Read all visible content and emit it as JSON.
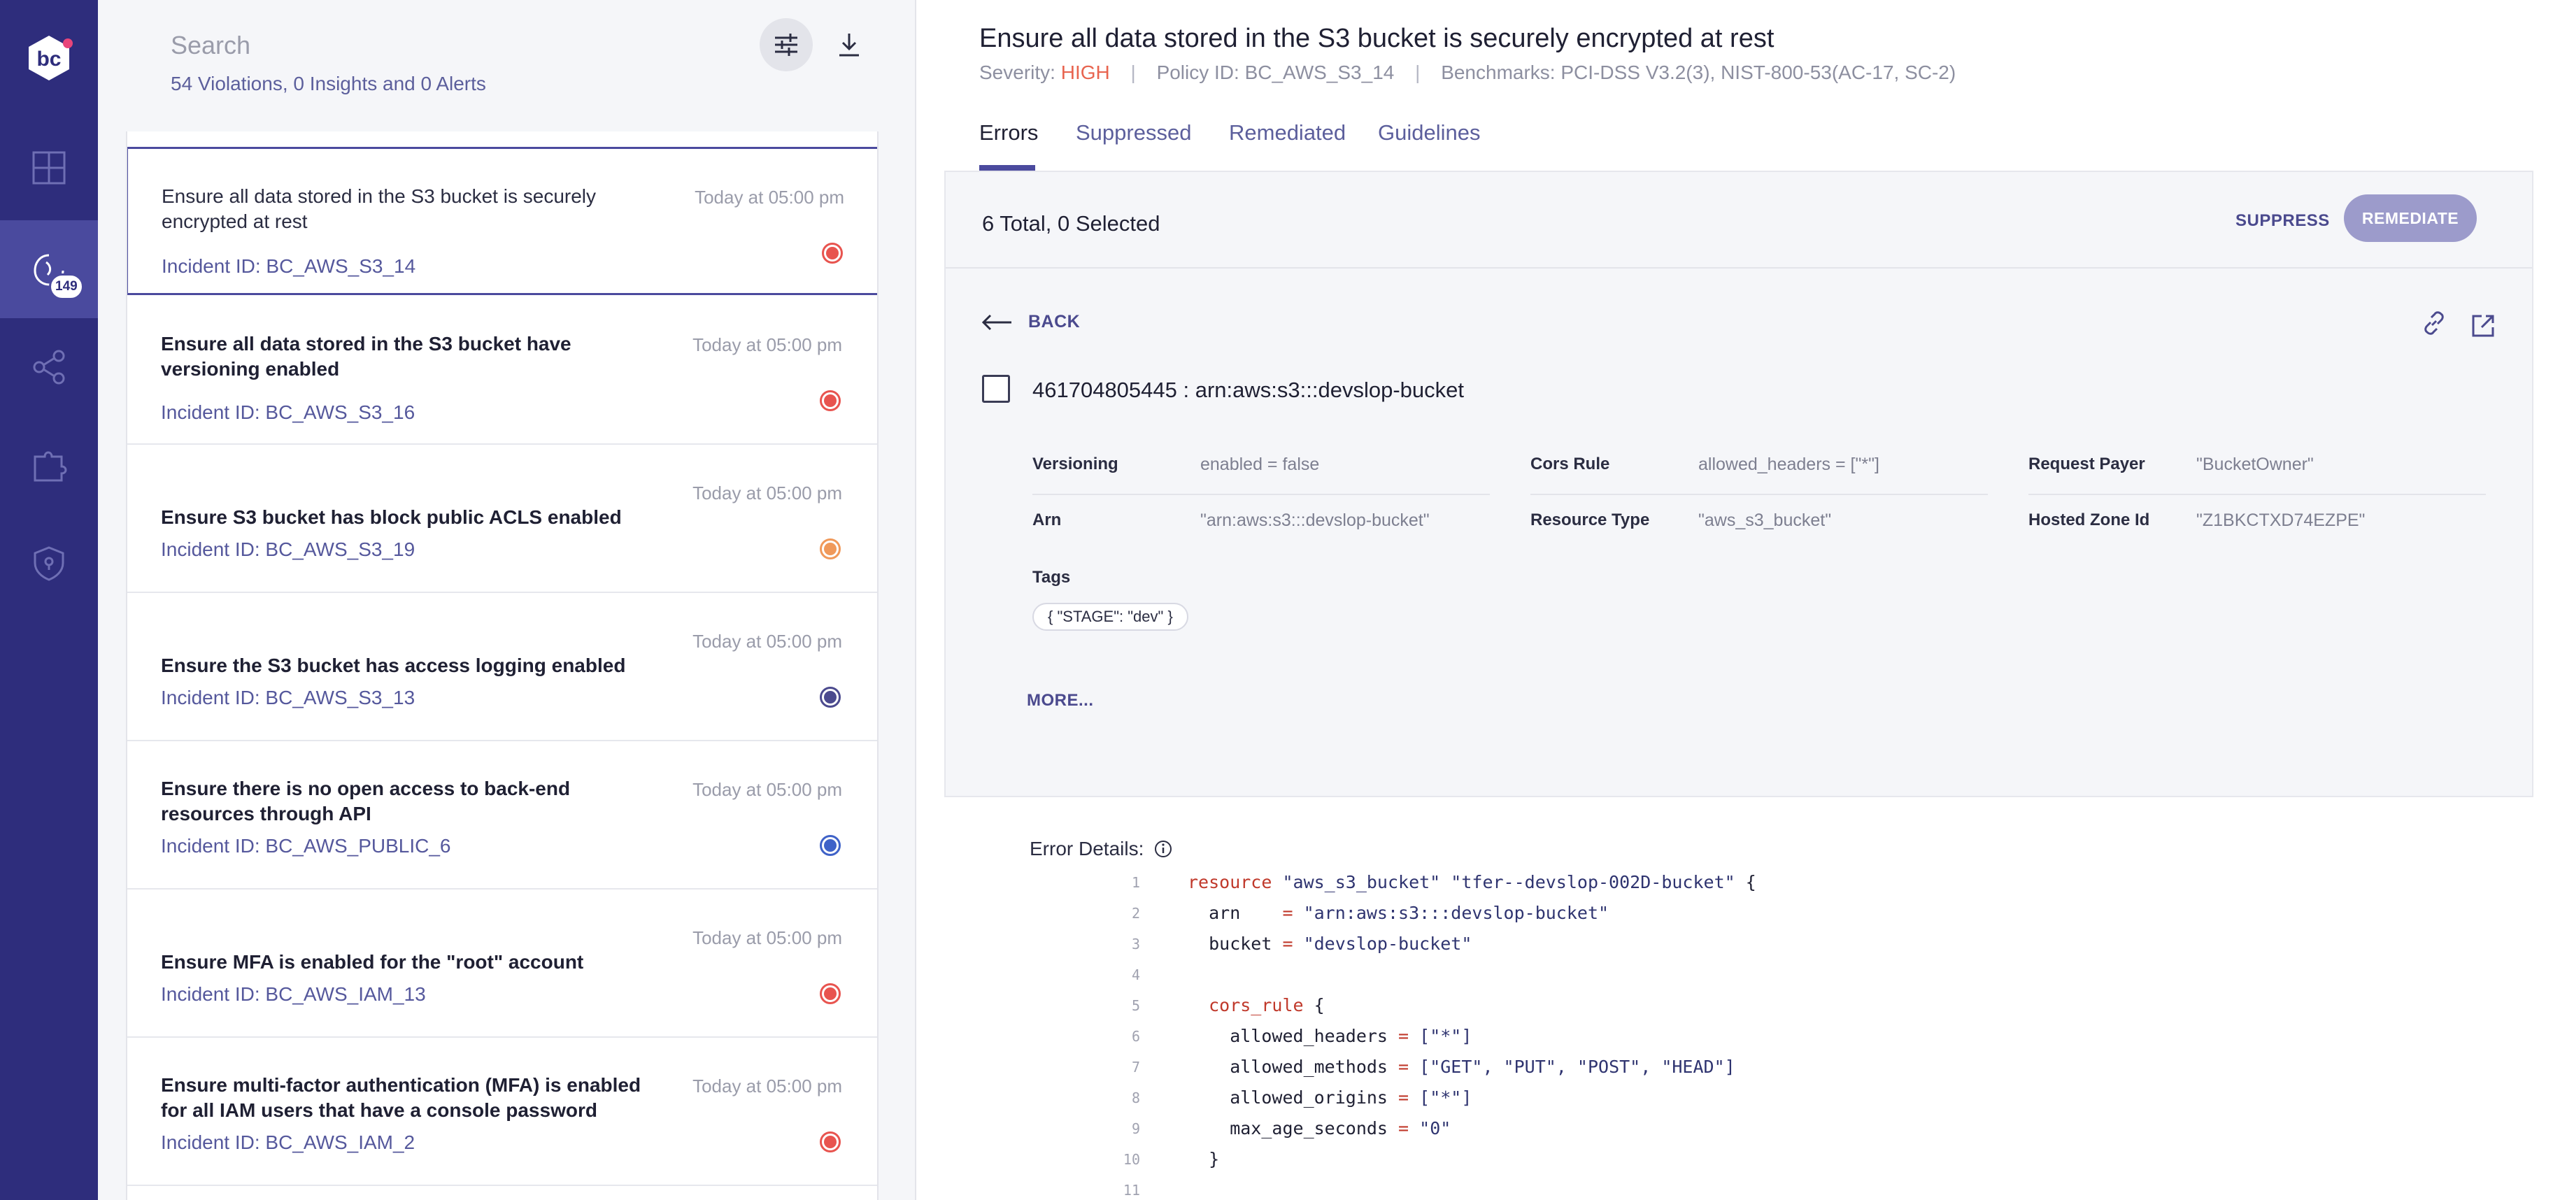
{
  "nav": {
    "badge": "149"
  },
  "list": {
    "search_placeholder": "Search",
    "summary": "54 Violations, 0 Insights and 0 Alerts",
    "items": [
      {
        "title": "Ensure all data stored in the S3 bucket is securely encrypted at rest",
        "incident": "Incident ID: BC_AWS_S3_14",
        "time": "Today at 05:00 pm",
        "severity_color": "#e8544f"
      },
      {
        "title": "Ensure all data stored in the S3 bucket have versioning enabled",
        "incident": "Incident ID: BC_AWS_S3_16",
        "time": "Today at 05:00 pm",
        "severity_color": "#e8544f"
      },
      {
        "title": "Ensure S3 bucket has block public ACLS enabled",
        "incident": "Incident ID: BC_AWS_S3_19",
        "time": "Today at 05:00 pm",
        "severity_color": "#f0995a"
      },
      {
        "title": "Ensure the S3 bucket has access logging enabled",
        "incident": "Incident ID: BC_AWS_S3_13",
        "time": "Today at 05:00 pm",
        "severity_color": "#4b4a8e"
      },
      {
        "title": "Ensure there is no open access to back-end resources through API",
        "incident": "Incident ID: BC_AWS_PUBLIC_6",
        "time": "Today at 05:00 pm",
        "severity_color": "#3f62c8"
      },
      {
        "title": "Ensure MFA is enabled for the \"root\" account",
        "incident": "Incident ID: BC_AWS_IAM_13",
        "time": "Today at 05:00 pm",
        "severity_color": "#e8544f"
      },
      {
        "title": "Ensure multi-factor authentication (MFA) is enabled for all IAM users that have a console password",
        "incident": "Incident ID: BC_AWS_IAM_2",
        "time": "Today at 05:00 pm",
        "severity_color": "#e8544f"
      }
    ]
  },
  "detail": {
    "title": "Ensure all data stored in the S3 bucket is securely encrypted at rest",
    "severity_label": "Severity:",
    "severity_value": "HIGH",
    "policy": "Policy ID: BC_AWS_S3_14",
    "benchmarks": "Benchmarks: PCI-DSS V3.2(3), NIST-800-53(AC-17, SC-2)",
    "tabs": [
      "Errors",
      "Suppressed",
      "Remediated",
      "Guidelines"
    ],
    "total": "6 Total, 0 Selected",
    "suppress_label": "SUPPRESS",
    "remediate_label": "REMEDIATE",
    "back_label": "BACK",
    "resource_id": "461704805445 : arn:aws:s3:::devslop-bucket",
    "attributes": [
      {
        "key": "Versioning",
        "value": "enabled = false"
      },
      {
        "key": "Cors Rule",
        "value": "allowed_headers = [\"*\"]"
      },
      {
        "key": "Request Payer",
        "value": "\"BucketOwner\""
      },
      {
        "key": "Arn",
        "value": "\"arn:aws:s3:::devslop-bucket\""
      },
      {
        "key": "Resource Type",
        "value": "\"aws_s3_bucket\""
      },
      {
        "key": "Hosted Zone Id",
        "value": "\"Z1BKCTXD74EZPE\""
      }
    ],
    "tags_label": "Tags",
    "tag_value": "{ \"STAGE\": \"dev\" }",
    "more_label": "MORE...",
    "error_details_label": "Error Details:",
    "code_lines": [
      {
        "n": "1",
        "parts": [
          [
            "kw",
            "resource "
          ],
          [
            "str",
            "\"aws_s3_bucket\" \"tfer--devslop-002D-bucket\" "
          ],
          [
            "plain",
            "{"
          ]
        ]
      },
      {
        "n": "2",
        "parts": [
          [
            "plain",
            "  arn    "
          ],
          [
            "op",
            "= "
          ],
          [
            "str",
            "\"arn:aws:s3:::devslop-bucket\""
          ]
        ]
      },
      {
        "n": "3",
        "parts": [
          [
            "plain",
            "  bucket "
          ],
          [
            "op",
            "= "
          ],
          [
            "str",
            "\"devslop-bucket\""
          ]
        ]
      },
      {
        "n": "4",
        "parts": []
      },
      {
        "n": "5",
        "parts": [
          [
            "kw",
            "  cors_rule "
          ],
          [
            "plain",
            "{"
          ]
        ]
      },
      {
        "n": "6",
        "parts": [
          [
            "plain",
            "    allowed_headers "
          ],
          [
            "op",
            "= "
          ],
          [
            "str",
            "[\"*\"]"
          ]
        ]
      },
      {
        "n": "7",
        "parts": [
          [
            "plain",
            "    allowed_methods "
          ],
          [
            "op",
            "= "
          ],
          [
            "str",
            "[\"GET\", \"PUT\", \"POST\", \"HEAD\"]"
          ]
        ]
      },
      {
        "n": "8",
        "parts": [
          [
            "plain",
            "    allowed_origins "
          ],
          [
            "op",
            "= "
          ],
          [
            "str",
            "[\"*\"]"
          ]
        ]
      },
      {
        "n": "9",
        "parts": [
          [
            "plain",
            "    max_age_seconds "
          ],
          [
            "op",
            "= "
          ],
          [
            "str",
            "\"0\""
          ]
        ]
      },
      {
        "n": "10",
        "parts": [
          [
            "plain",
            "  }"
          ]
        ]
      },
      {
        "n": "11",
        "parts": []
      }
    ]
  }
}
